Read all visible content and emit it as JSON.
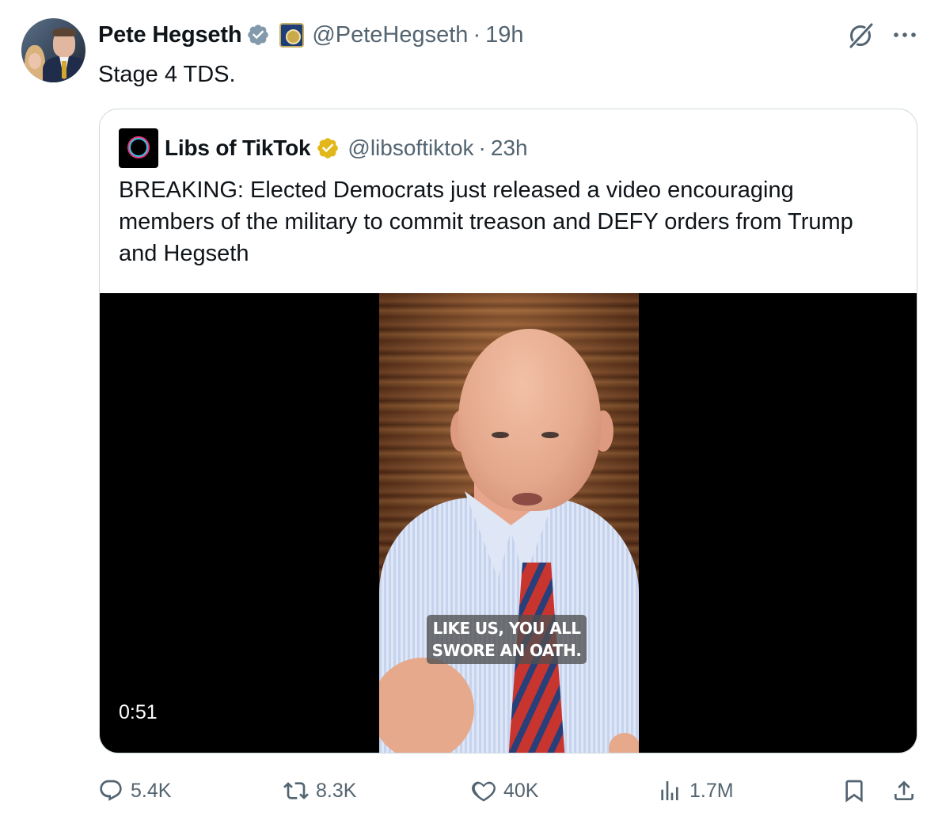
{
  "tweet": {
    "author_name": "Pete Hegseth",
    "handle": "@PeteHegseth",
    "separator": "·",
    "time": "19h",
    "text": "Stage 4 TDS."
  },
  "quoted": {
    "author_name": "Libs of TikTok",
    "handle": "@libsoftiktok",
    "separator": "·",
    "time": "23h",
    "avatar_text": "Libs of TikTok",
    "text": "BREAKING: Elected Democrats just released a video encouraging members of the military to commit treason and DEFY orders from Trump and Hegseth",
    "video": {
      "duration": "0:51",
      "caption_line1": "LIKE US, YOU ALL",
      "caption_line2": "SWORE AN OATH."
    }
  },
  "actions": {
    "reply_count": "5.4K",
    "repost_count": "8.3K",
    "like_count": "40K",
    "views_count": "1.7M"
  },
  "icons": {
    "verified": "verified-badge-icon",
    "gold_verified": "gold-verified-badge-icon",
    "grok": "grok-icon",
    "more": "more-dots-icon",
    "reply": "reply-icon",
    "repost": "repost-icon",
    "like": "heart-icon",
    "views": "views-icon",
    "bookmark": "bookmark-icon",
    "share": "share-icon"
  },
  "colors": {
    "text": "#0f1419",
    "secondary": "#536471",
    "verified_blue_grey": "#829aab",
    "gold": "#e2b719",
    "border": "#cfd9de"
  }
}
